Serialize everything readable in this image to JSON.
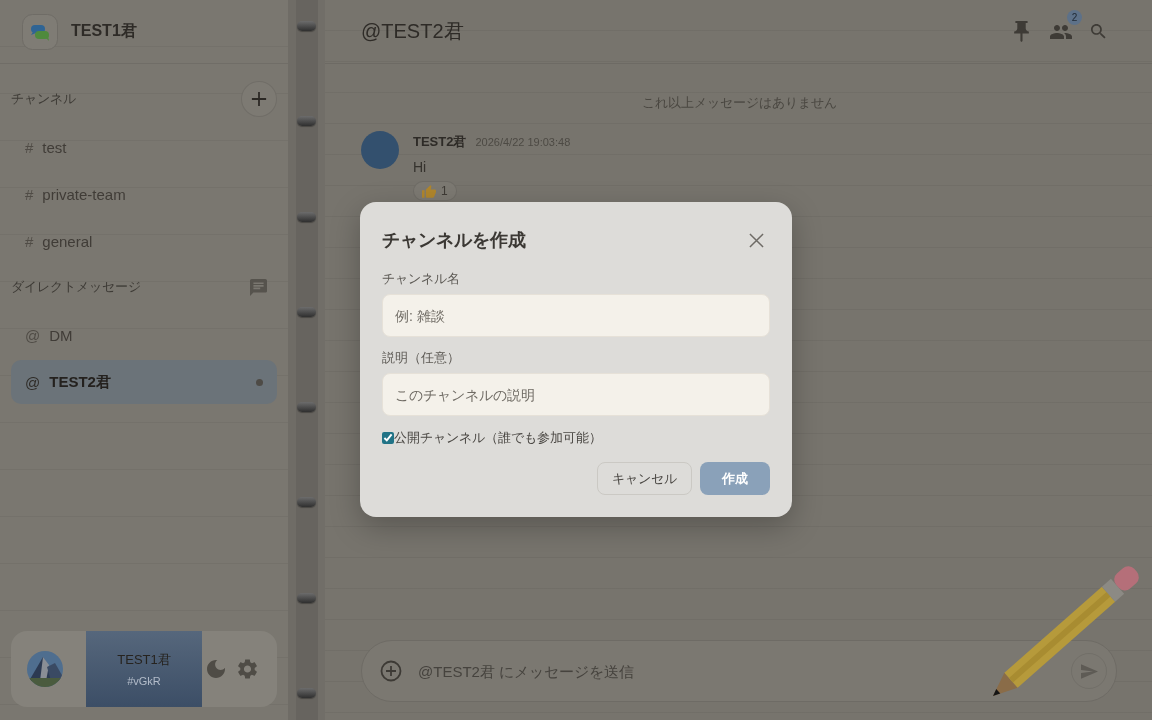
{
  "sidebar": {
    "workspace_name": "TEST1君",
    "sections": [
      {
        "kind": "channels",
        "title": "チャンネル",
        "items": [
          {
            "prefix": "#",
            "name": "test",
            "selected": false,
            "unread": false
          },
          {
            "prefix": "#",
            "name": "private-team",
            "selected": false,
            "unread": false
          },
          {
            "prefix": "#",
            "name": "general",
            "selected": false,
            "unread": false
          }
        ]
      },
      {
        "kind": "direct_messages",
        "title": "ダイレクトメッセージ",
        "items": [
          {
            "prefix": "@",
            "name": "DM",
            "selected": false,
            "unread": false
          },
          {
            "prefix": "@",
            "name": "TEST2君",
            "selected": true,
            "unread": true
          }
        ]
      }
    ],
    "user_panel": {
      "name": "TEST1君",
      "tag": "#vGkR"
    }
  },
  "conversation": {
    "title": "@TEST2君",
    "member_count": "2",
    "notice": "これ以上メッセージはありません",
    "messages": [
      {
        "author": "TEST2君",
        "time": "2026/4/22 19:03:48",
        "text": "Hi",
        "reactions": [
          {
            "count": "1"
          }
        ]
      }
    ],
    "composer": {
      "placeholder": "@TEST2君 にメッセージを送信"
    }
  },
  "dialog": {
    "title": "チャンネルを作成",
    "fields": [
      {
        "label": "チャンネル名",
        "placeholder": "例: 雑談"
      },
      {
        "label": "説明（任意）",
        "placeholder": "このチャンネルの説明"
      }
    ],
    "public_option": {
      "label": "公開チャンネル（誰でも参加可能）",
      "checked": true
    },
    "buttons": [
      {
        "kind": "secondary",
        "label": "キャンセル",
        "disabled": false
      },
      {
        "kind": "primary",
        "label": "作成",
        "disabled": true
      }
    ]
  }
}
